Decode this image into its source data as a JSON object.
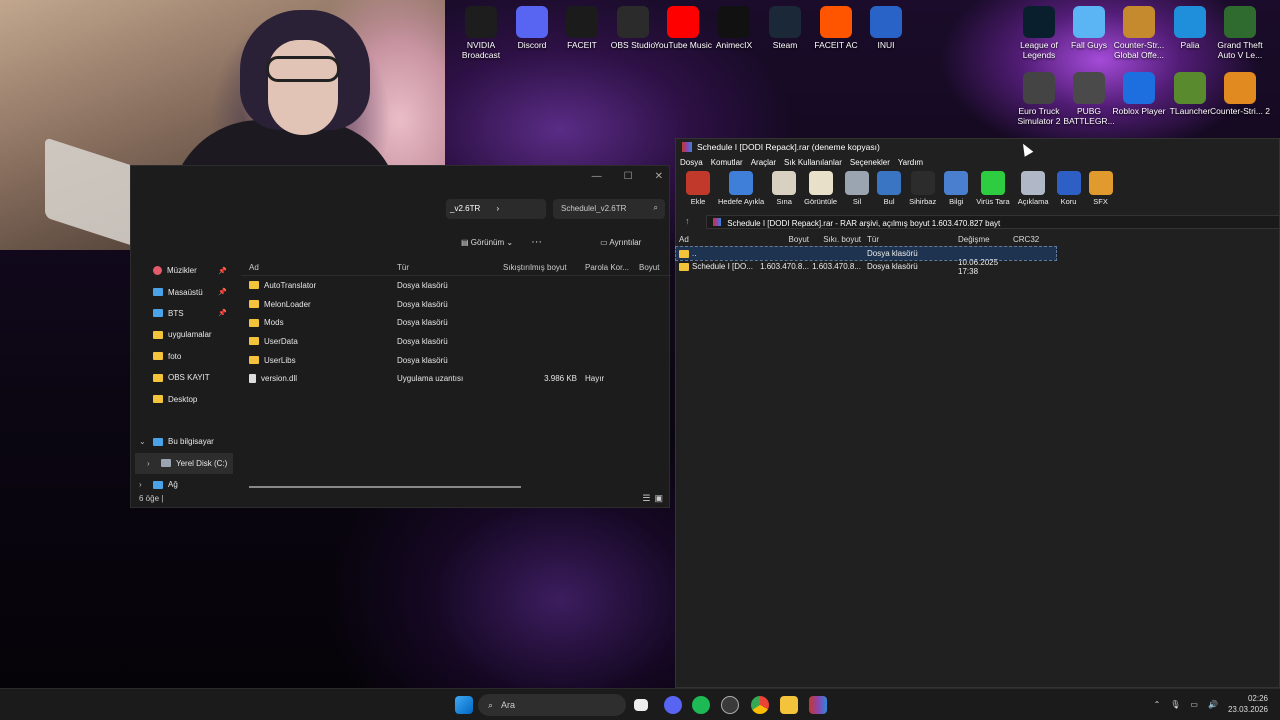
{
  "desktop": {
    "icons": [
      {
        "label": "NVIDIA Broadcast",
        "icon": "nvidia-broadcast-icon",
        "color": "#1d1d1d"
      },
      {
        "label": "Discord",
        "icon": "discord-icon",
        "color": "#5865f2"
      },
      {
        "label": "FACEIT",
        "icon": "faceit-icon",
        "color": "#1b1b1b"
      },
      {
        "label": "OBS Studio",
        "icon": "obs-icon",
        "color": "#2b2b2b"
      },
      {
        "label": "YouTube Music",
        "icon": "youtube-music-icon",
        "color": "#ff0000"
      },
      {
        "label": "AnimecIX",
        "icon": "animecix-icon",
        "color": "#111111"
      },
      {
        "label": "Steam",
        "icon": "steam-icon",
        "color": "#1b2838"
      },
      {
        "label": "FACEIT AC",
        "icon": "faceit-ac-icon",
        "color": "#ff5500"
      },
      {
        "label": "INUI",
        "icon": "inui-icon",
        "color": "#2a63c7"
      },
      {
        "label": "League of Legends",
        "icon": "league-icon",
        "color": "#0a1f2e"
      },
      {
        "label": "Fall Guys",
        "icon": "fall-guys-icon",
        "color": "#5bb5f5"
      },
      {
        "label": "Counter-Str... Global Offe...",
        "icon": "csgo-icon",
        "color": "#c58a2e"
      },
      {
        "label": "Palia",
        "icon": "palia-icon",
        "color": "#1f8fdc"
      },
      {
        "label": "Grand Theft Auto V Le...",
        "icon": "gta-icon",
        "color": "#2f6b2f"
      },
      {
        "label": "Euro Truck Simulator 2",
        "icon": "ets2-icon",
        "color": "#444444"
      },
      {
        "label": "PUBG BATTLEGR...",
        "icon": "pubg-icon",
        "color": "#4a4a4a"
      },
      {
        "label": "Roblox Player",
        "icon": "roblox-icon",
        "color": "#1d6fe0"
      },
      {
        "label": "TLauncher",
        "icon": "tlauncher-icon",
        "color": "#5a8a2e"
      },
      {
        "label": "Counter-Stri... 2",
        "icon": "cs2-icon",
        "color": "#e08a1f"
      }
    ]
  },
  "explorer": {
    "address_crumb": "_v2.6TR",
    "address_chevron": "›",
    "search_text": "Schedulel_v2.6TR",
    "view_label": "Görünüm",
    "more_label": "···",
    "details_label": "Ayrıntılar",
    "sidebar": [
      {
        "label": "Müzikler",
        "icon": "music-icon",
        "pinned": true
      },
      {
        "label": "Masaüstü",
        "icon": "desktop-icon",
        "pinned": true
      },
      {
        "label": "BTS",
        "icon": "folder-blue-icon",
        "pinned": true
      },
      {
        "label": "uygulamalar",
        "icon": "folder-icon",
        "pinned": false
      },
      {
        "label": "foto",
        "icon": "folder-icon",
        "pinned": false
      },
      {
        "label": "OBS KAYIT",
        "icon": "folder-icon",
        "pinned": false
      },
      {
        "label": "Desktop",
        "icon": "folder-icon",
        "pinned": false
      },
      {
        "label": "",
        "icon": "",
        "pinned": false
      },
      {
        "label": "Bu bilgisayar",
        "icon": "computer-icon",
        "pinned": false
      },
      {
        "label": "Yerel Disk (C:)",
        "icon": "drive-icon",
        "pinned": false
      },
      {
        "label": "Ağ",
        "icon": "network-icon",
        "pinned": false
      }
    ],
    "columns": [
      "Ad",
      "Tür",
      "Sıkıştırılmış boyut",
      "Parola Kor...",
      "Boyut"
    ],
    "files": [
      {
        "name": "AutoTranslator",
        "type": "Dosya klasörü",
        "csize": "",
        "pw": "",
        "size": "",
        "icon": "folder-icon"
      },
      {
        "name": "MelonLoader",
        "type": "Dosya klasörü",
        "csize": "",
        "pw": "",
        "size": "",
        "icon": "folder-icon"
      },
      {
        "name": "Mods",
        "type": "Dosya klasörü",
        "csize": "",
        "pw": "",
        "size": "",
        "icon": "folder-icon"
      },
      {
        "name": "UserData",
        "type": "Dosya klasörü",
        "csize": "",
        "pw": "",
        "size": "",
        "icon": "folder-icon"
      },
      {
        "name": "UserLibs",
        "type": "Dosya klasörü",
        "csize": "",
        "pw": "",
        "size": "",
        "icon": "folder-icon"
      },
      {
        "name": "version.dll",
        "type": "Uygulama uzantısı",
        "csize": "3.986 KB",
        "pw": "Hayır",
        "size": "",
        "icon": "file-icon"
      }
    ],
    "status": "6 öğe"
  },
  "winrar": {
    "title": "Schedule I [DODI Repack].rar (deneme kopyası)",
    "menu": [
      "Dosya",
      "Komutlar",
      "Araçlar",
      "Sık Kullanılanlar",
      "Seçenekler",
      "Yardım"
    ],
    "tools": [
      {
        "label": "Ekle",
        "icon": "add-archive-icon",
        "color": "#c0392b"
      },
      {
        "label": "Hedefe Ayıkla",
        "icon": "extract-folder-icon",
        "color": "#3f7fd9"
      },
      {
        "label": "Sına",
        "icon": "test-icon",
        "color": "#d8d0c0"
      },
      {
        "label": "Görüntüle",
        "icon": "view-book-icon",
        "color": "#e8e0c8"
      },
      {
        "label": "Sil",
        "icon": "trash-icon",
        "color": "#9aa5b1"
      },
      {
        "label": "Bul",
        "icon": "find-icon",
        "color": "#3a75c4"
      },
      {
        "label": "Sihirbaz",
        "icon": "wizard-icon",
        "color": "#2c2c2c"
      },
      {
        "label": "Bilgi",
        "icon": "info-icon",
        "color": "#4a7fd0"
      },
      {
        "label": "Virüs Tara",
        "icon": "virus-scan-icon",
        "color": "#2ecc40"
      },
      {
        "label": "Açıklama",
        "icon": "comment-icon",
        "color": "#b0b8c8"
      },
      {
        "label": "Koru",
        "icon": "protect-shield-icon",
        "color": "#2e5fc4"
      },
      {
        "label": "SFX",
        "icon": "sfx-icon",
        "color": "#e09a2e"
      }
    ],
    "path": "Schedule I [DODI Repack].rar - RAR arşivi, açılmış boyut 1.603.470.827 bayt",
    "columns": [
      "Ad",
      "Boyut",
      "Sıkı. boyut",
      "Tür",
      "Değişme",
      "CRC32"
    ],
    "rows": [
      {
        "name": "..",
        "size": "",
        "psize": "",
        "type": "Dosya klasörü",
        "modified": "",
        "crc": ""
      },
      {
        "name": "Schedule I [DO...",
        "size": "1.603.470.8...",
        "psize": "1.603.470.8...",
        "type": "Dosya klasörü",
        "modified": "10.06.2025 17:38",
        "crc": ""
      }
    ]
  },
  "taskbar": {
    "search_placeholder": "Ara",
    "time": "02:26",
    "date": "23.03.2026",
    "accent": "#0078d4"
  }
}
